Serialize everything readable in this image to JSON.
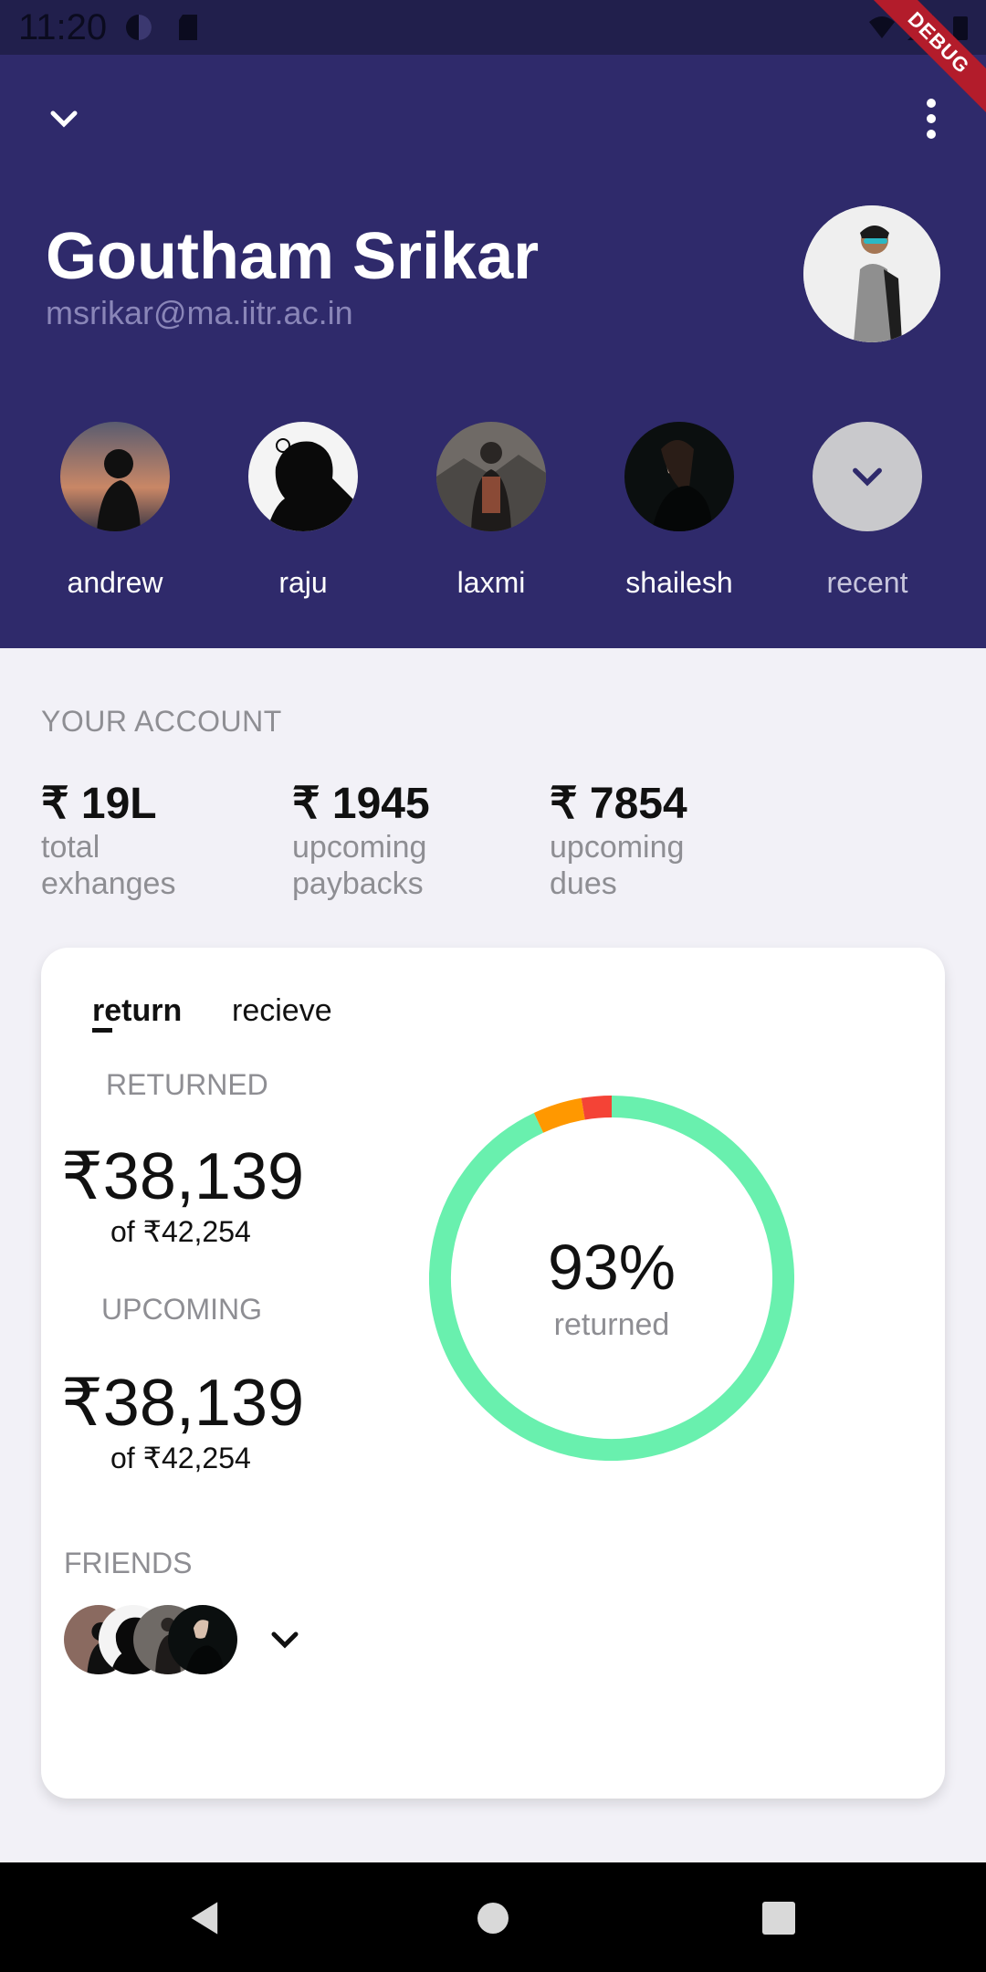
{
  "status_bar": {
    "time": "11:20"
  },
  "debug_banner": "DEBUG",
  "profile": {
    "name": "Goutham Srikar",
    "email": "msrikar@ma.iitr.ac.in"
  },
  "contacts": [
    {
      "label": "andrew"
    },
    {
      "label": "raju"
    },
    {
      "label": "laxmi"
    },
    {
      "label": "shailesh"
    },
    {
      "label": "recent"
    }
  ],
  "account": {
    "section_title": "YOUR ACCOUNT",
    "stats": [
      {
        "value": "₹ 19L",
        "label": "total exhanges"
      },
      {
        "value": "₹ 1945",
        "label": "upcoming paybacks"
      },
      {
        "value": "₹ 7854",
        "label": "upcoming dues"
      }
    ]
  },
  "card": {
    "tabs": [
      {
        "label": "return"
      },
      {
        "label": "recieve"
      }
    ],
    "returned": {
      "title": "RETURNED",
      "amount": "₹38,139",
      "of": "of ₹42,254"
    },
    "upcoming": {
      "title": "UPCOMING",
      "amount": "₹38,139",
      "of": "of ₹42,254"
    },
    "donut": {
      "percent_label": "93%",
      "sub_label": "returned",
      "returned_fraction": 0.93
    },
    "friends": {
      "title": "FRIENDS"
    }
  },
  "colors": {
    "header_bg": "#2f2a6b",
    "donut_green": "#69f0ae",
    "donut_orange": "#ff9800",
    "donut_red": "#f44336"
  }
}
